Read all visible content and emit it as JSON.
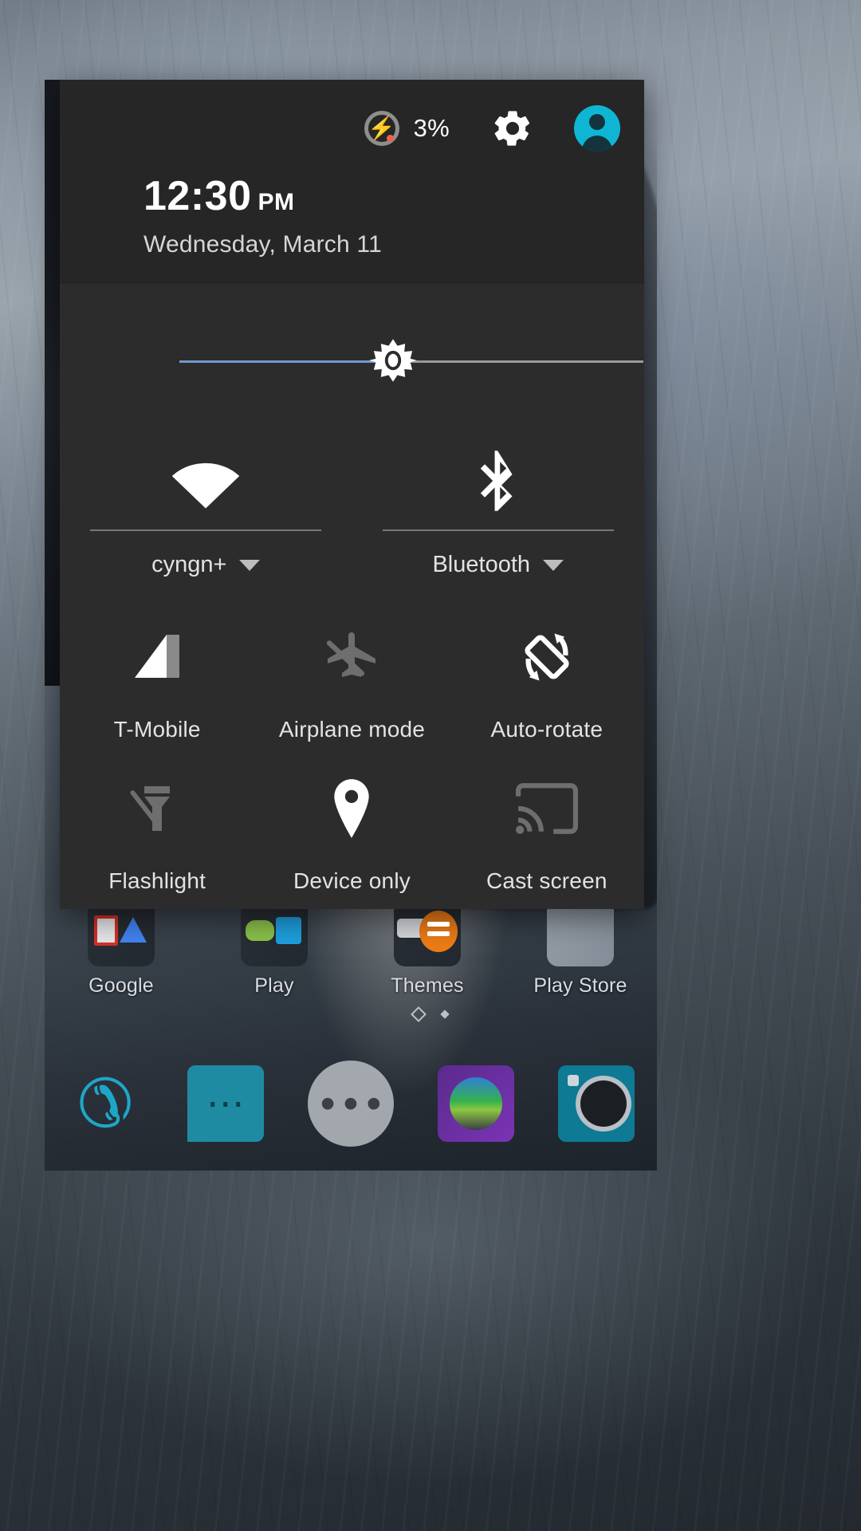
{
  "panel": {
    "status": {
      "battery_icon": "battery-charging-icon",
      "battery_percent": "3%",
      "settings_icon": "gear-icon",
      "avatar_icon": "user-avatar-icon"
    },
    "clock": {
      "time": "12:30",
      "ampm": "PM",
      "date": "Wednesday, March 11"
    },
    "brightness": {
      "icon": "brightness-sun-icon",
      "value_percent": 46,
      "fill_color": "#6f9bd1",
      "track_color": "#9a9a9a"
    },
    "dual_tiles": [
      {
        "icon": "wifi-icon",
        "label": "cyngn+",
        "state": "on",
        "has_dropdown": true
      },
      {
        "icon": "bluetooth-icon",
        "label": "Bluetooth",
        "state": "on",
        "has_dropdown": true
      }
    ],
    "tiles": [
      {
        "icon": "signal-bars-icon",
        "label": "T-Mobile",
        "state": "on"
      },
      {
        "icon": "airplane-off-icon",
        "label": "Airplane mode",
        "state": "off"
      },
      {
        "icon": "auto-rotate-icon",
        "label": "Auto-rotate",
        "state": "on"
      },
      {
        "icon": "flashlight-off-icon",
        "label": "Flashlight",
        "state": "off"
      },
      {
        "icon": "location-pin-icon",
        "label": "Device only",
        "state": "on"
      },
      {
        "icon": "cast-screen-icon",
        "label": "Cast screen",
        "state": "off"
      }
    ]
  },
  "home": {
    "apps": [
      {
        "icon": "google-folder-icon",
        "label": "Google"
      },
      {
        "icon": "play-folder-icon",
        "label": "Play"
      },
      {
        "icon": "themes-folder-icon",
        "label": "Themes"
      },
      {
        "icon": "play-store-icon",
        "label": "Play Store"
      }
    ],
    "dock": [
      {
        "icon": "phone-icon",
        "label": "Phone"
      },
      {
        "icon": "messaging-icon",
        "label": "Messaging"
      },
      {
        "icon": "app-drawer-icon",
        "label": "Apps"
      },
      {
        "icon": "gallery-icon",
        "label": "Gallery"
      },
      {
        "icon": "camera-icon",
        "label": "Camera"
      }
    ]
  },
  "colors": {
    "panel_bg": "#2c2c2c",
    "header_bg": "#262626",
    "accent_cyan": "#0fb6d4",
    "slider_blue": "#6f9bd1",
    "icon_on": "#ffffff",
    "icon_off": "#6e6e6e",
    "label": "#e3e3e3",
    "battery_low": "#e8654a"
  }
}
